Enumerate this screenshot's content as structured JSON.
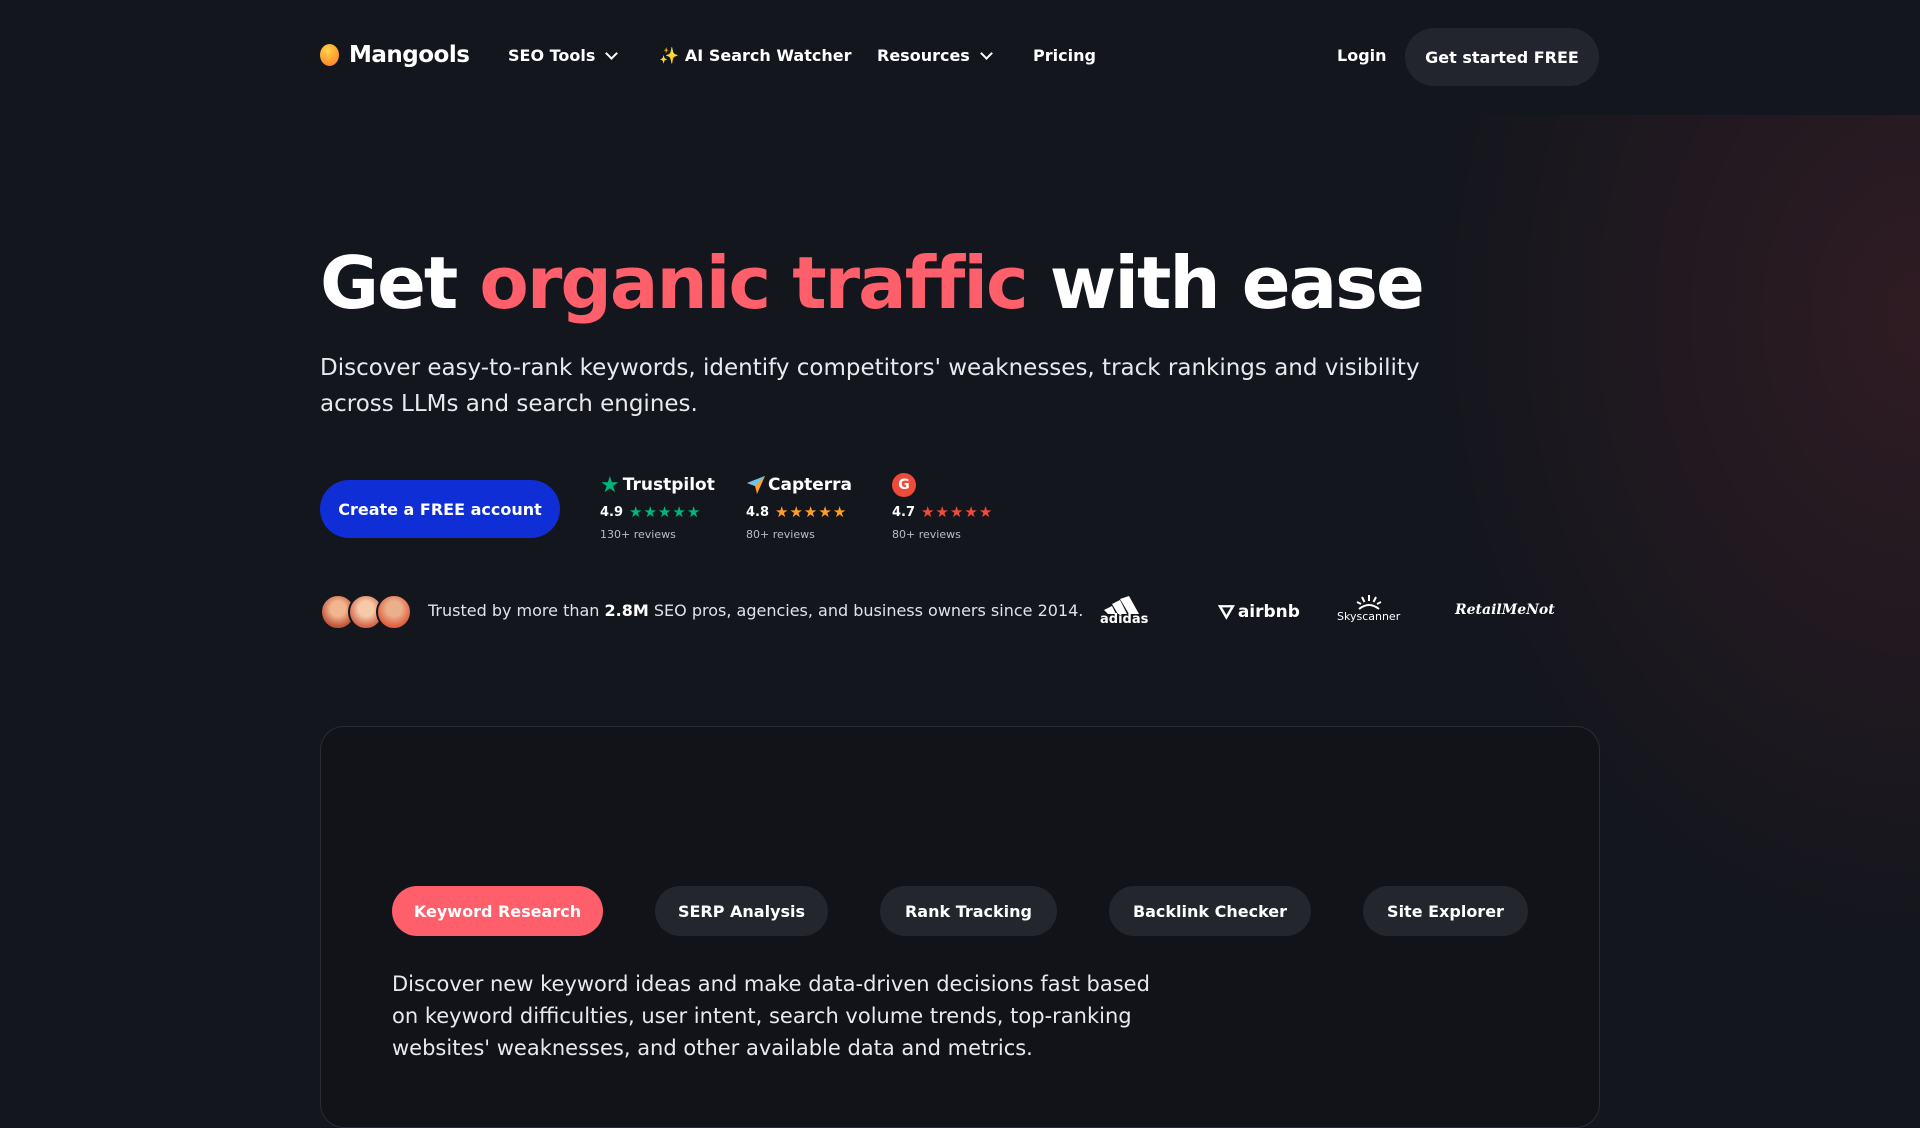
{
  "brand": {
    "name": "Mangools"
  },
  "nav": {
    "items": [
      {
        "label": "SEO Tools",
        "dropdown": true
      },
      {
        "label": "AI Search Watcher",
        "icon": "sparkle-icon"
      },
      {
        "label": "Resources",
        "dropdown": true
      },
      {
        "label": "Pricing"
      }
    ],
    "login": "Login",
    "cta": "Get started FREE"
  },
  "hero": {
    "title_start": "Get ",
    "title_accent": "organic traffic",
    "title_end": " with ease",
    "subtitle": "Discover easy-to-rank keywords, identify competitors' weaknesses, track rankings and visibility across LLMs and search engines.",
    "cta": "Create a FREE account"
  },
  "ratings": [
    {
      "brand": "Trustpilot",
      "score": "4.9",
      "reviews": "130+ reviews",
      "star_color": "#00b67a"
    },
    {
      "brand": "Capterra",
      "score": "4.8",
      "reviews": "80+ reviews",
      "star_color": "#ff9d28"
    },
    {
      "brand": "G",
      "score": "4.7",
      "reviews": "80+ reviews",
      "star_color": "#ef4b3a"
    }
  ],
  "trusted": {
    "prefix": "Trusted by more than ",
    "highlight": "2.8M",
    "suffix": " SEO pros, agencies, and business owners since 2014.",
    "logos": [
      "adidas",
      "airbnb",
      "Skyscanner",
      "RetailMeNot"
    ]
  },
  "tabs": [
    {
      "label": "Keyword Research",
      "active": true
    },
    {
      "label": "SERP Analysis",
      "active": false
    },
    {
      "label": "Rank Tracking",
      "active": false
    },
    {
      "label": "Backlink Checker",
      "active": false
    },
    {
      "label": "Site Explorer",
      "active": false
    }
  ],
  "feature": {
    "description": "Discover new keyword ideas and make data-driven decisions fast based on keyword difficulties, user intent, search volume trends, top-ranking websites' weaknesses, and other available data and metrics."
  },
  "colors": {
    "accent": "#ff5f6a",
    "primary_button": "#0f2ed6",
    "background": "#14161d"
  }
}
